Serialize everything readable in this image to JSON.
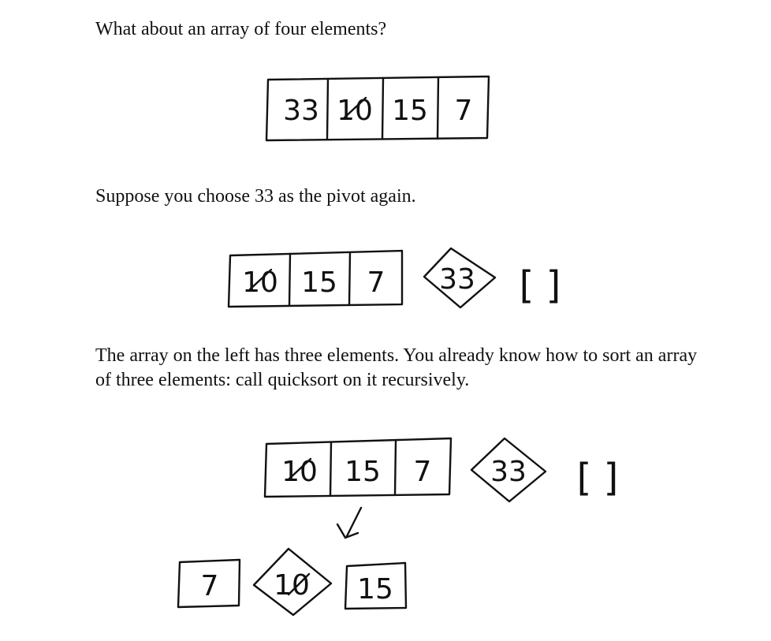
{
  "paragraphs": {
    "p1": "What about an array of four elements?",
    "p2": "Suppose you choose 33 as the pivot again.",
    "p3": "The array on the left has three elements. You already know how to sort an array of three elements: call quicksort on it recursively."
  },
  "figure1": {
    "array": [
      "33",
      "10",
      "15",
      "7"
    ]
  },
  "figure2": {
    "left_array": [
      "10",
      "15",
      "7"
    ],
    "pivot": "33",
    "right_array": "[ ]"
  },
  "figure3": {
    "left_array": [
      "10",
      "15",
      "7"
    ],
    "pivot": "33",
    "right_array": "[ ]",
    "sub_left": "7",
    "sub_pivot": "10",
    "sub_right": "15"
  }
}
